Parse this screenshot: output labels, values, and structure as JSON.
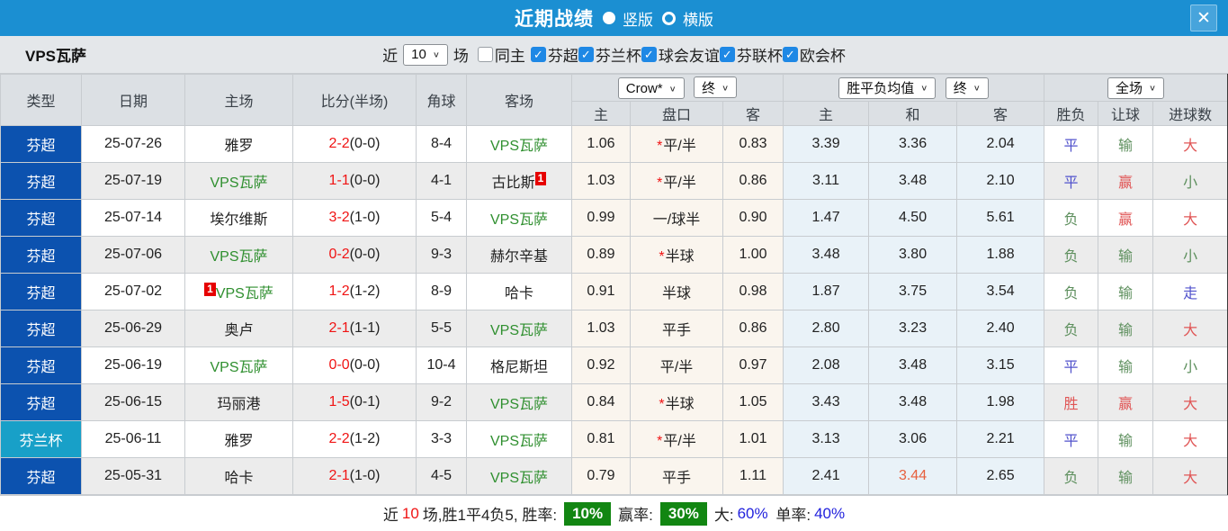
{
  "topbar": {
    "title": "近期战绩",
    "radio_vertical": "竖版",
    "radio_horizontal": "横版",
    "close": "✕"
  },
  "filter": {
    "team": "VPS瓦萨",
    "near_label": "近",
    "matches_value": "10",
    "field_label": "场",
    "same_home_label": "同主",
    "leagues": [
      "芬超",
      "芬兰杯",
      "球会友谊",
      "芬联杯",
      "欧会杯"
    ]
  },
  "header": {
    "cols": [
      "类型",
      "日期",
      "主场",
      "比分(半场)",
      "角球",
      "客场"
    ],
    "odds_select": "Crow*",
    "odds_state_select": "终",
    "avg_select": "胜平负均值",
    "avg_state_select": "终",
    "period_select": "全场",
    "sub": [
      "主",
      "盘口",
      "客",
      "主",
      "和",
      "客",
      "胜负",
      "让球",
      "进球数"
    ],
    "chevron": "∨"
  },
  "rows": [
    {
      "league": "芬超",
      "cup": false,
      "date": "25-07-26",
      "home": {
        "name": "雅罗",
        "vps": false
      },
      "score_ft": "2-2",
      "score_ht": "(0-0)",
      "corners": "8-4",
      "away": {
        "name": "VPS瓦萨",
        "vps": true
      },
      "odds_home": "1.06",
      "handicap": "平/半",
      "handicap_star": true,
      "odds_away": "0.83",
      "avg_home": "3.39",
      "avg_draw": "3.36",
      "avg_away": "2.04",
      "avg_draw_color": null,
      "result": {
        "text": "平",
        "color": "blue"
      },
      "handicap_result": {
        "text": "输",
        "color": "green"
      },
      "goals_result": {
        "text": "大",
        "color": "red"
      }
    },
    {
      "league": "芬超",
      "cup": false,
      "date": "25-07-19",
      "home": {
        "name": "VPS瓦萨",
        "vps": true
      },
      "score_ft": "1-1",
      "score_ht": "(0-0)",
      "corners": "4-1",
      "away": {
        "name": "古比斯",
        "vps": false,
        "badge": "1",
        "badge_pos": "after"
      },
      "odds_home": "1.03",
      "handicap": "平/半",
      "handicap_star": true,
      "odds_away": "0.86",
      "avg_home": "3.11",
      "avg_draw": "3.48",
      "avg_away": "2.10",
      "avg_draw_color": null,
      "result": {
        "text": "平",
        "color": "blue"
      },
      "handicap_result": {
        "text": "赢",
        "color": "red"
      },
      "goals_result": {
        "text": "小",
        "color": "green"
      }
    },
    {
      "league": "芬超",
      "cup": false,
      "date": "25-07-14",
      "home": {
        "name": "埃尔维斯",
        "vps": false
      },
      "score_ft": "3-2",
      "score_ht": "(1-0)",
      "corners": "5-4",
      "away": {
        "name": "VPS瓦萨",
        "vps": true
      },
      "odds_home": "0.99",
      "handicap": "一/球半",
      "handicap_star": false,
      "odds_away": "0.90",
      "avg_home": "1.47",
      "avg_draw": "4.50",
      "avg_away": "5.61",
      "avg_draw_color": null,
      "result": {
        "text": "负",
        "color": "green"
      },
      "handicap_result": {
        "text": "赢",
        "color": "red"
      },
      "goals_result": {
        "text": "大",
        "color": "red"
      }
    },
    {
      "league": "芬超",
      "cup": false,
      "date": "25-07-06",
      "home": {
        "name": "VPS瓦萨",
        "vps": true
      },
      "score_ft": "0-2",
      "score_ht": "(0-0)",
      "corners": "9-3",
      "away": {
        "name": "赫尔辛基",
        "vps": false
      },
      "odds_home": "0.89",
      "handicap": "半球",
      "handicap_star": true,
      "odds_away": "1.00",
      "avg_home": "3.48",
      "avg_draw": "3.80",
      "avg_away": "1.88",
      "avg_draw_color": null,
      "result": {
        "text": "负",
        "color": "green"
      },
      "handicap_result": {
        "text": "输",
        "color": "green"
      },
      "goals_result": {
        "text": "小",
        "color": "green"
      }
    },
    {
      "league": "芬超",
      "cup": false,
      "date": "25-07-02",
      "home": {
        "name": "VPS瓦萨",
        "vps": true,
        "badge": "1",
        "badge_pos": "before"
      },
      "score_ft": "1-2",
      "score_ht": "(1-2)",
      "corners": "8-9",
      "away": {
        "name": "哈卡",
        "vps": false
      },
      "odds_home": "0.91",
      "handicap": "半球",
      "handicap_star": false,
      "odds_away": "0.98",
      "avg_home": "1.87",
      "avg_draw": "3.75",
      "avg_away": "3.54",
      "avg_draw_color": null,
      "result": {
        "text": "负",
        "color": "green"
      },
      "handicap_result": {
        "text": "输",
        "color": "green"
      },
      "goals_result": {
        "text": "走",
        "color": "blue"
      }
    },
    {
      "league": "芬超",
      "cup": false,
      "date": "25-06-29",
      "home": {
        "name": "奥卢",
        "vps": false
      },
      "score_ft": "2-1",
      "score_ht": "(1-1)",
      "corners": "5-5",
      "away": {
        "name": "VPS瓦萨",
        "vps": true
      },
      "odds_home": "1.03",
      "handicap": "平手",
      "handicap_star": false,
      "odds_away": "0.86",
      "avg_home": "2.80",
      "avg_draw": "3.23",
      "avg_away": "2.40",
      "avg_draw_color": null,
      "result": {
        "text": "负",
        "color": "green"
      },
      "handicap_result": {
        "text": "输",
        "color": "green"
      },
      "goals_result": {
        "text": "大",
        "color": "red"
      }
    },
    {
      "league": "芬超",
      "cup": false,
      "date": "25-06-19",
      "home": {
        "name": "VPS瓦萨",
        "vps": true
      },
      "score_ft": "0-0",
      "score_ht": "(0-0)",
      "corners": "10-4",
      "away": {
        "name": "格尼斯坦",
        "vps": false
      },
      "odds_home": "0.92",
      "handicap": "平/半",
      "handicap_star": false,
      "odds_away": "0.97",
      "avg_home": "2.08",
      "avg_draw": "3.48",
      "avg_away": "3.15",
      "avg_draw_color": null,
      "result": {
        "text": "平",
        "color": "blue"
      },
      "handicap_result": {
        "text": "输",
        "color": "green"
      },
      "goals_result": {
        "text": "小",
        "color": "green"
      }
    },
    {
      "league": "芬超",
      "cup": false,
      "date": "25-06-15",
      "home": {
        "name": "玛丽港",
        "vps": false
      },
      "score_ft": "1-5",
      "score_ht": "(0-1)",
      "corners": "9-2",
      "away": {
        "name": "VPS瓦萨",
        "vps": true
      },
      "odds_home": "0.84",
      "handicap": "半球",
      "handicap_star": true,
      "odds_away": "1.05",
      "avg_home": "3.43",
      "avg_draw": "3.48",
      "avg_away": "1.98",
      "avg_draw_color": null,
      "result": {
        "text": "胜",
        "color": "red"
      },
      "handicap_result": {
        "text": "赢",
        "color": "red"
      },
      "goals_result": {
        "text": "大",
        "color": "red"
      }
    },
    {
      "league": "芬兰杯",
      "cup": true,
      "date": "25-06-11",
      "home": {
        "name": "雅罗",
        "vps": false
      },
      "score_ft": "2-2",
      "score_ht": "(1-2)",
      "corners": "3-3",
      "away": {
        "name": "VPS瓦萨",
        "vps": true
      },
      "odds_home": "0.81",
      "handicap": "平/半",
      "handicap_star": true,
      "odds_away": "1.01",
      "avg_home": "3.13",
      "avg_draw": "3.06",
      "avg_away": "2.21",
      "avg_draw_color": null,
      "result": {
        "text": "平",
        "color": "blue"
      },
      "handicap_result": {
        "text": "输",
        "color": "green"
      },
      "goals_result": {
        "text": "大",
        "color": "red"
      }
    },
    {
      "league": "芬超",
      "cup": false,
      "date": "25-05-31",
      "home": {
        "name": "哈卡",
        "vps": false
      },
      "score_ft": "2-1",
      "score_ht": "(1-0)",
      "corners": "4-5",
      "away": {
        "name": "VPS瓦萨",
        "vps": true
      },
      "odds_home": "0.79",
      "handicap": "平手",
      "handicap_star": false,
      "odds_away": "1.11",
      "avg_home": "2.41",
      "avg_draw": "3.44",
      "avg_away": "2.65",
      "avg_draw_color": "orange",
      "result": {
        "text": "负",
        "color": "green"
      },
      "handicap_result": {
        "text": "输",
        "color": "green"
      },
      "goals_result": {
        "text": "大",
        "color": "red"
      }
    }
  ],
  "summary": {
    "prefix": "近",
    "count": "10",
    "mid": "场,胜1平4负5, 胜率:",
    "win_rate": "10%",
    "label_win_odds": "赢率:",
    "win_odds_rate": "30%",
    "label_big": "大:",
    "big_rate": "60%",
    "label_single": " 单率:",
    "single_rate": "40%"
  },
  "colors": {
    "topbar_blue": "#1b8fd2",
    "league_blue": "#0c52af",
    "cup_cyan": "#18a0c8",
    "team_green": "#2f8f2f",
    "score_red": "#f01414",
    "odds_bg": "#faf5ee",
    "avg_bg": "#e9f2f8",
    "summary_badge_green": "#128612",
    "summary_blue": "#2222dd"
  }
}
